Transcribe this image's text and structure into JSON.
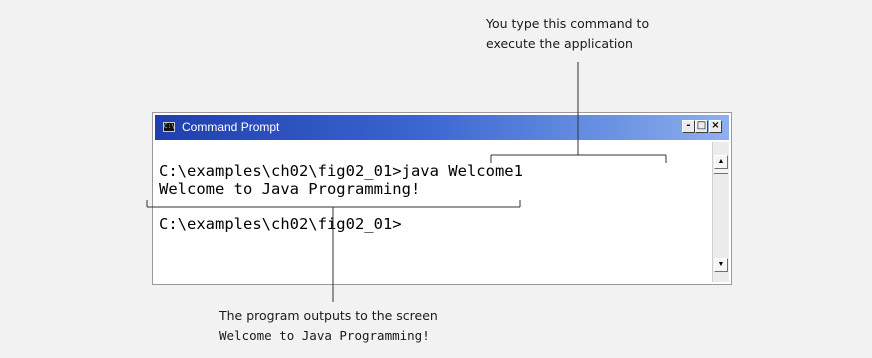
{
  "callouts": {
    "top_line1": "You type this command to",
    "top_line2": "execute the application",
    "bottom_line1": "The program outputs to the screen",
    "bottom_code": "Welcome to Java Programming!"
  },
  "window": {
    "title": "Command Prompt",
    "icon_glyph": "C:\\",
    "minimize_label": "-",
    "maximize_label": "□",
    "close_label": "×"
  },
  "console": {
    "line1": "C:\\examples\\ch02\\fig02_01>java Welcome1",
    "line2": "Welcome to Java Programming!",
    "line3": "C:\\examples\\ch02\\fig02_01>"
  },
  "scrollbar": {
    "up_arrow": "▲",
    "down_arrow": "▼"
  },
  "icons": {
    "window_icon": "command-prompt-icon",
    "minimize": "minimize-icon",
    "maximize": "maximize-icon",
    "close": "close-icon"
  },
  "colors": {
    "titlebar_start": "#1f3fae",
    "titlebar_end": "#8fb0ec",
    "page_background": "#f2f2f2",
    "console_background": "#ffffff",
    "callout_line": "#333333"
  }
}
